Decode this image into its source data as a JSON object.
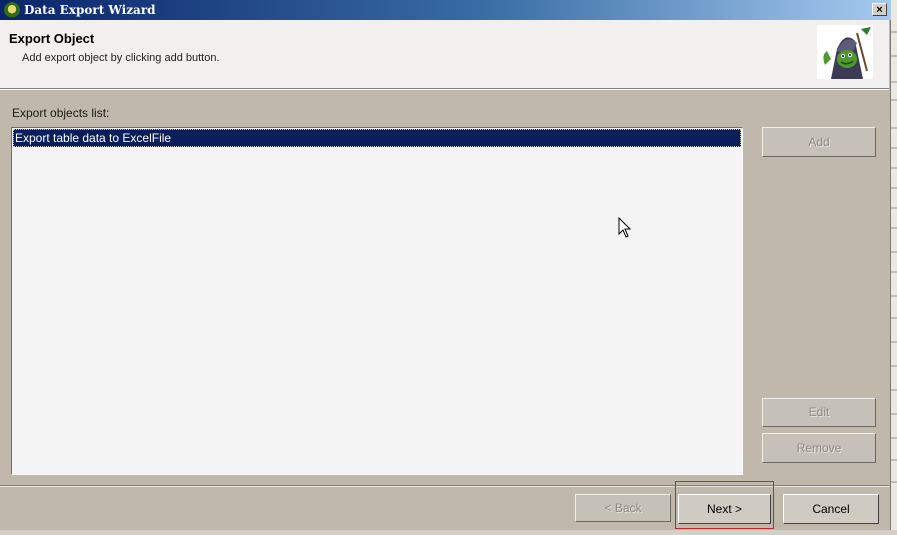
{
  "window": {
    "title": "Data Export Wizard",
    "close_glyph": "×"
  },
  "header": {
    "title": "Export Object",
    "description": "Add export object by clicking add button."
  },
  "list": {
    "label": "Export objects list:",
    "items": [
      "Export table data  to ExcelFile"
    ]
  },
  "buttons": {
    "add": "Add",
    "edit": "Edit",
    "remove": "Remove",
    "back": "< Back",
    "next": "Next >",
    "cancel": "Cancel"
  },
  "colors": {
    "selection": "#0a1e5c",
    "highlight": "#c62828"
  },
  "icons": {
    "app": "toad-app-icon",
    "logo": "toad-logo-icon",
    "cursor": "mouse-cursor-icon"
  }
}
